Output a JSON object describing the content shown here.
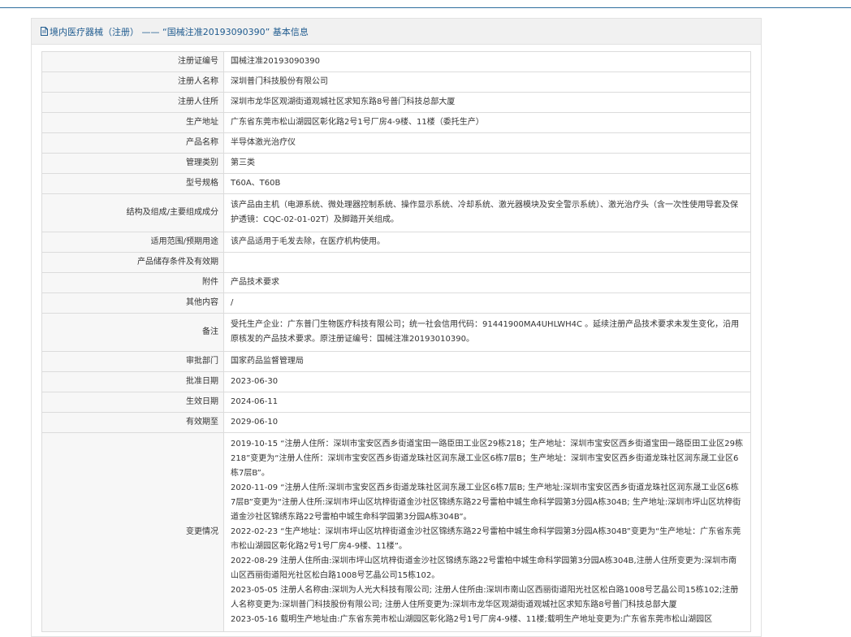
{
  "header": {
    "icon": "document-icon",
    "title": "境内医疗器械（注册） —— “国械注准20193090390” 基本信息"
  },
  "rows": [
    {
      "label": "注册证编号",
      "value": "国械注准20193090390"
    },
    {
      "label": "注册人名称",
      "value": "深圳普门科技股份有限公司"
    },
    {
      "label": "注册人住所",
      "value": "深圳市龙华区观湖街道观城社区求知东路8号普门科技总部大厦"
    },
    {
      "label": "生产地址",
      "value": "广东省东莞市松山湖园区彰化路2号1号厂房4-9楼、11楼（委托生产）"
    },
    {
      "label": "产品名称",
      "value": "半导体激光治疗仪"
    },
    {
      "label": "管理类别",
      "value": "第三类"
    },
    {
      "label": "型号规格",
      "value": "T60A、T60B"
    },
    {
      "label": "结构及组成/主要组成成分",
      "value": "该产品由主机（电源系统、微处理器控制系统、操作显示系统、冷却系统、激光器模块及安全警示系统）、激光治疗头（含一次性使用导套及保护透镜：CQC-02-01-02T）及脚踏开关组成。"
    },
    {
      "label": "适用范围/预期用途",
      "value": "该产品适用于毛发去除，在医疗机构使用。"
    },
    {
      "label": "产品储存条件及有效期",
      "value": ""
    },
    {
      "label": "附件",
      "value": "产品技术要求"
    },
    {
      "label": "其他内容",
      "value": "/"
    },
    {
      "label": "备注",
      "value": "受托生产企业：广东普门生物医疗科技有限公司；统一社会信用代码：91441900MA4UHLWH4C 。延续注册产品技术要求未发生变化，沿用原核发的产品技术要求。原注册证编号：国械注准20193010390。"
    },
    {
      "label": "审批部门",
      "value": "国家药品监督管理局"
    },
    {
      "label": "批准日期",
      "value": "2023-06-30"
    },
    {
      "label": "生效日期",
      "value": "2024-06-11"
    },
    {
      "label": "有效期至",
      "value": "2029-06-10"
    }
  ],
  "changes": {
    "label": "变更情况",
    "entries": [
      "2019-10-15 “注册人住所：深圳市宝安区西乡街道宝田一路臣田工业区29栋218；生产地址：深圳市宝安区西乡街道宝田一路臣田工业区29栋218”变更为“注册人住所：深圳市宝安区西乡街道龙珠社区润东晟工业区6栋7层B；生产地址：深圳市宝安区西乡街道龙珠社区润东晟工业区6栋7层B”。",
      "2020-11-09 “注册人住所:深圳市宝安区西乡街道龙珠社区润东晟工业区6栋7层B; 生产地址:深圳市宝安区西乡街道龙珠社区润东晟工业区6栋7层B”变更为“注册人住所:深圳市坪山区坑梓街道金沙社区锦绣东路22号雷柏中城生命科学园第3分园A栋304B; 生产地址:深圳市坪山区坑梓街道金沙社区锦绣东路22号雷柏中城生命科学园第3分园A栋304B”。",
      "2022-02-23 “生产地址：深圳市坪山区坑梓街道金沙社区锦绣东路22号雷柏中城生命科学园第3分园A栋304B”变更为“生产地址：广东省东莞市松山湖园区彰化路2号1号厂房4-9楼、11楼”。",
      "2022-08-29 注册人住所由:深圳市坪山区坑梓街道金沙社区锦绣东路22号雷柏中城生命科学园第3分园A栋304B,注册人住所变更为:深圳市南山区西丽街道阳光社区松白路1008号艺晶公司15栋102。",
      "2023-05-05 注册人名称由:深圳为人光大科技有限公司; 注册人住所由:深圳市南山区西丽街道阳光社区松白路1008号艺晶公司15栋102;注册人名称变更为:深圳普门科技股份有限公司; 注册人住所变更为:深圳市龙华区观湖街道观城社区求知东路8号普门科技总部大厦",
      "2023-05-16 载明生产地址由:广东省东莞市松山湖园区彰化路2号1号厂房4-9楼、11楼;载明生产地址变更为:广东省东莞市松山湖园区"
    ]
  },
  "colors": {
    "accent": "#1f5b8f",
    "top_rule": "#2e6e9e",
    "label_bg": "#f7f7f7",
    "border": "#dcdcdc",
    "header_bg": "#f1f1f1"
  }
}
